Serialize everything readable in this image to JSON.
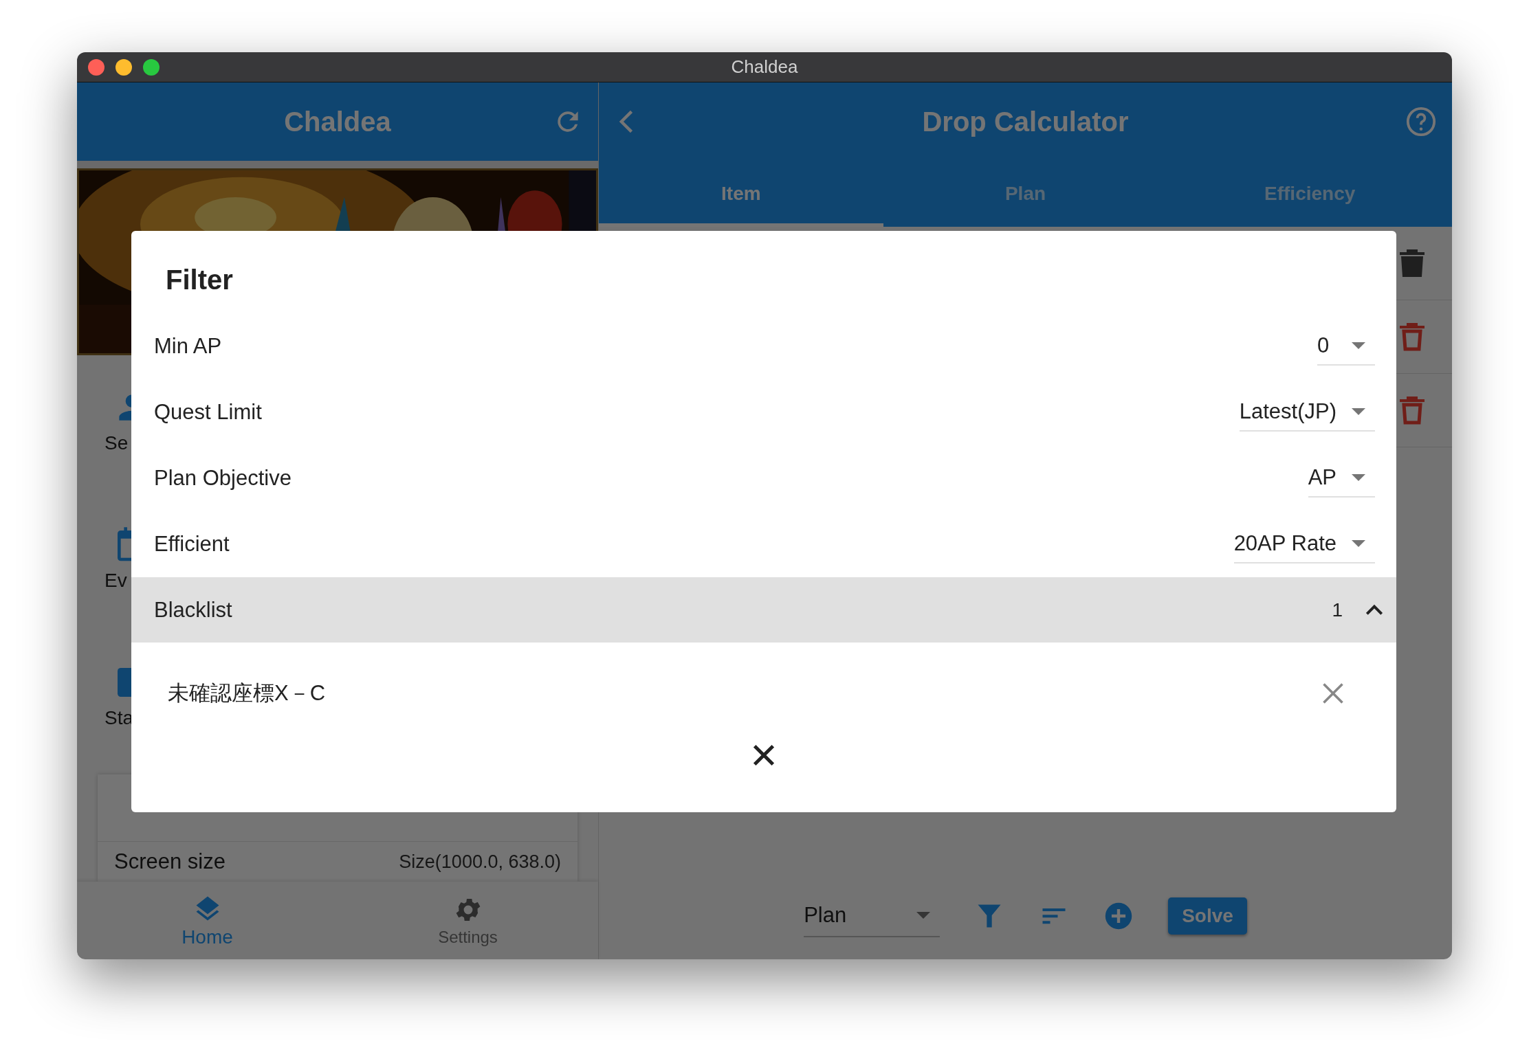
{
  "window": {
    "title": "Chaldea"
  },
  "sidebar": {
    "title": "Chaldea",
    "items": [
      {
        "label": "Se",
        "kind": "person"
      },
      {
        "label": "Ev",
        "kind": "calendar"
      },
      {
        "label": "Sta",
        "kind": "square"
      }
    ],
    "info_card": {
      "rows": [
        {
          "label": "Screen size",
          "value": "Size(1000.0, 638.0)"
        }
      ]
    },
    "bottom_nav": [
      {
        "label": "Home",
        "selected": true
      },
      {
        "label": "Settings",
        "selected": false
      }
    ]
  },
  "main": {
    "title": "Drop Calculator",
    "tabs": [
      {
        "label": "Item",
        "selected": true
      },
      {
        "label": "Plan",
        "selected": false
      },
      {
        "label": "Efficiency",
        "selected": false
      }
    ],
    "rows": [
      {
        "disabled": true
      },
      {
        "disabled": false
      },
      {
        "disabled": false
      }
    ],
    "toolbar": {
      "mode": "Plan",
      "solve": "Solve"
    }
  },
  "dialog": {
    "title": "Filter",
    "options": [
      {
        "label": "Min AP",
        "value": "0"
      },
      {
        "label": "Quest Limit",
        "value": "Latest(JP)"
      },
      {
        "label": "Plan Objective",
        "value": "AP"
      },
      {
        "label": "Efficient",
        "value": "20AP Rate"
      }
    ],
    "blacklist": {
      "label": "Blacklist",
      "count": "1",
      "expanded": true,
      "items": [
        "未確認座標X－C"
      ]
    }
  }
}
